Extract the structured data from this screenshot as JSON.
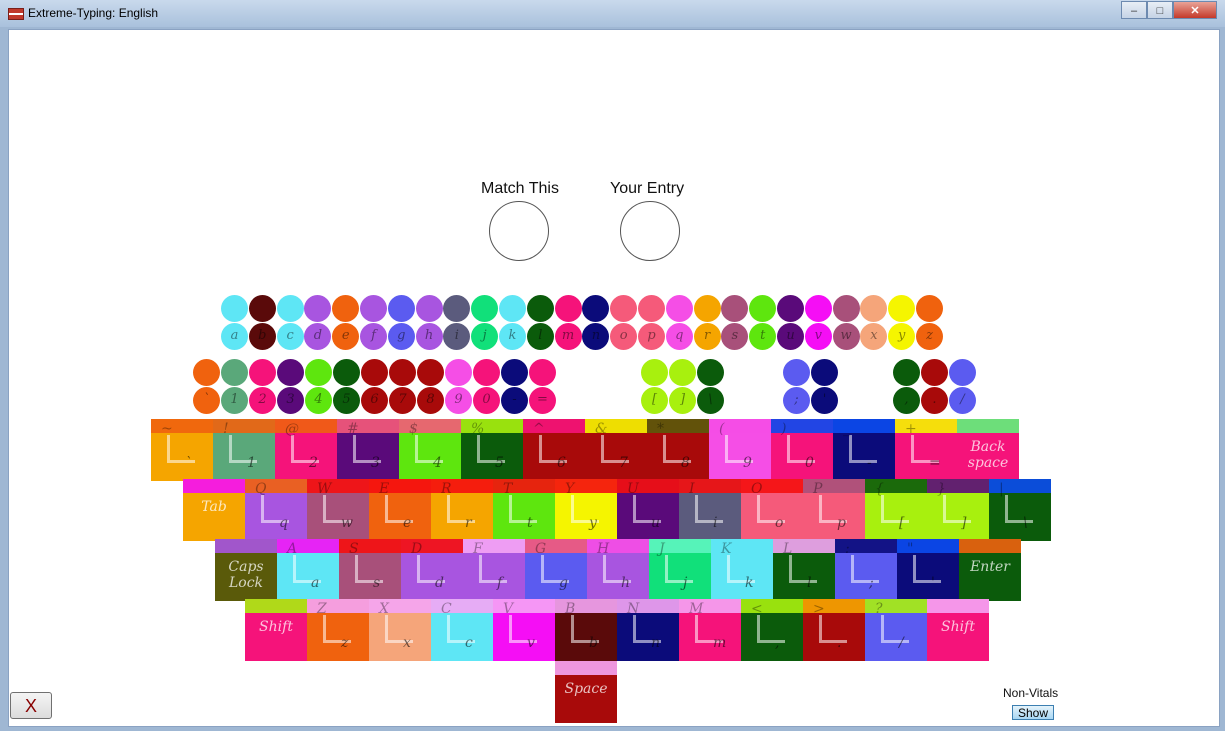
{
  "window": {
    "title": "Extreme-Typing: English"
  },
  "headers": {
    "match": "Match This",
    "entry": "Your Entry"
  },
  "alphabet": [
    {
      "ch": "a",
      "c": "#5ee6f5"
    },
    {
      "ch": "b",
      "c": "#5a0a0a"
    },
    {
      "ch": "c",
      "c": "#5ee6f5"
    },
    {
      "ch": "d",
      "c": "#a855e0"
    },
    {
      "ch": "e",
      "c": "#f0620e"
    },
    {
      "ch": "f",
      "c": "#a855e0"
    },
    {
      "ch": "g",
      "c": "#5b5bf0"
    },
    {
      "ch": "h",
      "c": "#a855e0"
    },
    {
      "ch": "i",
      "c": "#5b5b7d"
    },
    {
      "ch": "j",
      "c": "#11e07a"
    },
    {
      "ch": "k",
      "c": "#5ee6f5"
    },
    {
      "ch": "l",
      "c": "#0b5b0b"
    },
    {
      "ch": "m",
      "c": "#f5137a"
    },
    {
      "ch": "n",
      "c": "#0b0b7a"
    },
    {
      "ch": "o",
      "c": "#f55a7a"
    },
    {
      "ch": "p",
      "c": "#f55a7a"
    },
    {
      "ch": "q",
      "c": "#f54ee6"
    },
    {
      "ch": "r",
      "c": "#f5a500"
    },
    {
      "ch": "s",
      "c": "#a8507a"
    },
    {
      "ch": "t",
      "c": "#5ee60e"
    },
    {
      "ch": "u",
      "c": "#5a0a7a"
    },
    {
      "ch": "v",
      "c": "#f50ef5"
    },
    {
      "ch": "w",
      "c": "#a8507a"
    },
    {
      "ch": "x",
      "c": "#f5a57a"
    },
    {
      "ch": "y",
      "c": "#f5f500"
    },
    {
      "ch": "z",
      "c": "#f0620e"
    }
  ],
  "numbers": [
    {
      "ch": "`",
      "c": "#f0620e"
    },
    {
      "ch": "1",
      "c": "#5aa87a"
    },
    {
      "ch": "2",
      "c": "#f5137a"
    },
    {
      "ch": "3",
      "c": "#5a0a7a"
    },
    {
      "ch": "4",
      "c": "#5ee60e"
    },
    {
      "ch": "5",
      "c": "#0b5b0b"
    },
    {
      "ch": "6",
      "c": "#a80a0a"
    },
    {
      "ch": "7",
      "c": "#a80a0a"
    },
    {
      "ch": "8",
      "c": "#a80a0a"
    },
    {
      "ch": "9",
      "c": "#f54ee6"
    },
    {
      "ch": "0",
      "c": "#f5137a"
    },
    {
      "ch": "-",
      "c": "#0b0b7a"
    },
    {
      "ch": "=",
      "c": "#f5137a"
    }
  ],
  "brackets": [
    {
      "ch": "[",
      "c": "#a8f00e"
    },
    {
      "ch": "]",
      "c": "#a8f00e"
    },
    {
      "ch": "\\",
      "c": "#0b5b0b"
    }
  ],
  "semis": [
    {
      "ch": ";",
      "c": "#5b5bf0"
    },
    {
      "ch": "'",
      "c": "#0b0b7a"
    }
  ],
  "punct": [
    {
      "ch": ",",
      "c": "#0b5b0b"
    },
    {
      "ch": ".",
      "c": "#a80a0a"
    },
    {
      "ch": "/",
      "c": "#5b5bf0"
    }
  ],
  "rows": [
    [
      {
        "sh": "~",
        "ch": "`",
        "c": "#f5a500",
        "b": "#f0620e"
      },
      {
        "sh": "!",
        "ch": "1",
        "c": "#5aa87a",
        "b": "#f0620e"
      },
      {
        "sh": "@",
        "ch": "2",
        "c": "#f5137a",
        "b": "#f0620e"
      },
      {
        "sh": "#",
        "ch": "3",
        "c": "#5a0a7a",
        "b": "#f55a7a"
      },
      {
        "sh": "$",
        "ch": "4",
        "c": "#5ee60e",
        "b": "#f55a7a"
      },
      {
        "sh": "%",
        "ch": "5",
        "c": "#0b5b0b",
        "b": "#a8f00e"
      },
      {
        "sh": "^",
        "ch": "6",
        "c": "#a80a0a",
        "b": "#f5137a"
      },
      {
        "sh": "&",
        "ch": "7",
        "c": "#a80a0a",
        "b": "#f5f500"
      },
      {
        "sh": "*",
        "ch": "8",
        "c": "#a80a0a",
        "b": "#5a5a0a"
      },
      {
        "sh": "(",
        "ch": "9",
        "c": "#f54ee6",
        "b": "#f54ee6"
      },
      {
        "sh": ")",
        "ch": "0",
        "c": "#f5137a",
        "b": "#0b4bf0"
      },
      {
        "sh": "_",
        "ch": "-",
        "c": "#0b0b7a",
        "b": "#0b4bf0"
      },
      {
        "sh": "+",
        "ch": "=",
        "c": "#f5137a",
        "b": "#f5f500"
      },
      {
        "word": "Back space",
        "c": "#f5137a",
        "b": "#5ef57a"
      }
    ],
    [
      {
        "word": "Tab",
        "c": "#f5a500",
        "b": "#f50ef5"
      },
      {
        "sh": "Q",
        "ch": "q",
        "c": "#a855e0",
        "b": "#f0620e"
      },
      {
        "sh": "W",
        "ch": "w",
        "c": "#a8507a",
        "b": "#f50e0e"
      },
      {
        "sh": "E",
        "ch": "e",
        "c": "#f0620e",
        "b": "#f50e0e"
      },
      {
        "sh": "R",
        "ch": "r",
        "c": "#f5a500",
        "b": "#f50e0e"
      },
      {
        "sh": "T",
        "ch": "t",
        "c": "#5ee60e",
        "b": "#f50e0e"
      },
      {
        "sh": "Y",
        "ch": "y",
        "c": "#f5f500",
        "b": "#f50e0e"
      },
      {
        "sh": "U",
        "ch": "u",
        "c": "#5a0a7a",
        "b": "#f50e0e"
      },
      {
        "sh": "I",
        "ch": "i",
        "c": "#5b5b7d",
        "b": "#f50e0e"
      },
      {
        "sh": "O",
        "ch": "o",
        "c": "#f55a7a",
        "b": "#f50e0e"
      },
      {
        "sh": "P",
        "ch": "p",
        "c": "#f55a7a",
        "b": "#a8507a"
      },
      {
        "sh": "{",
        "ch": "[",
        "c": "#a8f00e",
        "b": "#0b5b0b"
      },
      {
        "sh": "}",
        "ch": "]",
        "c": "#a8f00e",
        "b": "#5a0a7a"
      },
      {
        "sh": "|",
        "ch": "\\",
        "c": "#0b5b0b",
        "b": "#0b4bf0"
      }
    ],
    [
      {
        "word": "Caps Lock",
        "c": "#5a5a0a",
        "b": "#a855e0"
      },
      {
        "sh": "A",
        "ch": "a",
        "c": "#5ee6f5",
        "b": "#f50ef5"
      },
      {
        "sh": "S",
        "ch": "s",
        "c": "#a8507a",
        "b": "#f50e0e"
      },
      {
        "sh": "D",
        "ch": "d",
        "c": "#a855e0",
        "b": "#f50e0e"
      },
      {
        "sh": "F",
        "ch": "f",
        "c": "#a855e0",
        "b": "#f5a5f5"
      },
      {
        "sh": "G",
        "ch": "g",
        "c": "#5b5bf0",
        "b": "#f55a7a"
      },
      {
        "sh": "H",
        "ch": "h",
        "c": "#a855e0",
        "b": "#f54ee6"
      },
      {
        "sh": "J",
        "ch": "j",
        "c": "#11e07a",
        "b": "#5ef5c0"
      },
      {
        "sh": "K",
        "ch": "k",
        "c": "#5ee6f5",
        "b": "#5ee6f5"
      },
      {
        "sh": "L",
        "ch": "l",
        "c": "#0b5b0b",
        "b": "#f5a5f5"
      },
      {
        "sh": ":",
        "ch": ";",
        "c": "#5b5bf0",
        "b": "#0b0b7a"
      },
      {
        "sh": "\"",
        "ch": "'",
        "c": "#0b0b7a",
        "b": "#0b4bf0"
      },
      {
        "word": "Enter",
        "c": "#0b5b0b",
        "b": "#f0620e"
      }
    ],
    [
      {
        "word": "Shift",
        "c": "#f5137a",
        "b": "#a8f00e"
      },
      {
        "sh": "Z",
        "ch": "z",
        "c": "#f0620e",
        "b": "#f5a5f5"
      },
      {
        "sh": "X",
        "ch": "x",
        "c": "#f5a57a",
        "b": "#f5a5f5"
      },
      {
        "sh": "C",
        "ch": "c",
        "c": "#5ee6f5",
        "b": "#f5a5f5"
      },
      {
        "sh": "V",
        "ch": "v",
        "c": "#f50ef5",
        "b": "#f5a5f5"
      },
      {
        "sh": "B",
        "ch": "b",
        "c": "#5a0a0a",
        "b": "#f5a5f5"
      },
      {
        "sh": "N",
        "ch": "n",
        "c": "#0b0b7a",
        "b": "#f5a5f5"
      },
      {
        "sh": "M",
        "ch": "m",
        "c": "#f5137a",
        "b": "#f5a5f5"
      },
      {
        "sh": "<",
        "ch": ",",
        "c": "#0b5b0b",
        "b": "#a8f00e"
      },
      {
        "sh": ">",
        "ch": ".",
        "c": "#a80a0a",
        "b": "#f5a500"
      },
      {
        "sh": "?",
        "ch": "/",
        "c": "#5b5bf0",
        "b": "#a8f00e"
      },
      {
        "word": "Shift",
        "c": "#f5137a",
        "b": "#f5a5f5"
      }
    ]
  ],
  "space": {
    "word": "Space",
    "c": "#a80a0a",
    "b": "#f5a5f5"
  },
  "close_label": "X",
  "nonvitals": {
    "label": "Non-Vitals",
    "button": "Show"
  }
}
